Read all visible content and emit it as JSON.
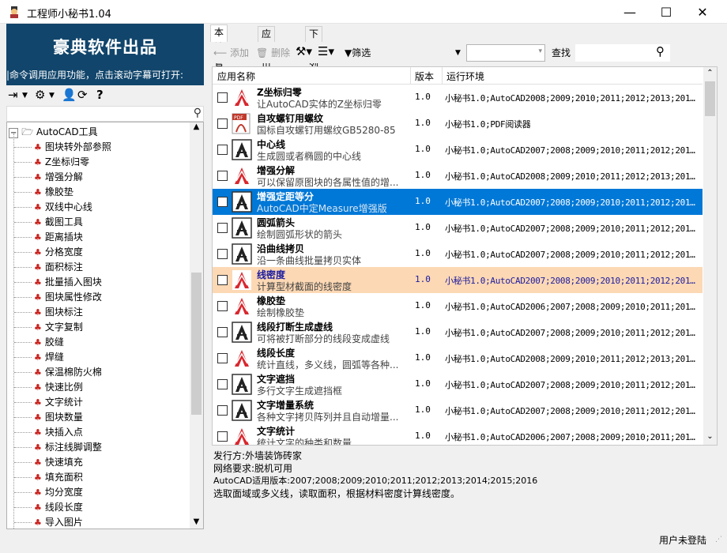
{
  "window": {
    "title": "工程师小秘书1.04",
    "minimize": "—",
    "maximize": "☐",
    "close": "✕"
  },
  "banner": {
    "title": "豪典软件出品",
    "marquee": "|命令调用应用功能，点击滚动字幕可打开:"
  },
  "left_toolbar": {
    "icons": [
      "exit-icon",
      "settings-icon",
      "user-icon",
      "refresh-icon",
      "help-icon"
    ]
  },
  "tree": {
    "root": "AutoCAD工具",
    "items": [
      "图块转外部参照",
      "Z坐标归零",
      "增强分解",
      "橡胶垫",
      "双线中心线",
      "截图工具",
      "距离插块",
      "分格宽度",
      "面积标注",
      "批量插入图块",
      "图块属性修改",
      "图块标注",
      "文字复制",
      "胶缝",
      "焊缝",
      "保温棉防火棉",
      "快速比例",
      "文字统计",
      "图块数量",
      "块插入点",
      "标注线脚调整",
      "快速填充",
      "填充面积",
      "均分宽度",
      "线段长度",
      "导入图片"
    ]
  },
  "tabs": [
    "本地管理",
    "应用市场",
    "下载列表"
  ],
  "toolbar": {
    "add": "添加",
    "delete": "删除",
    "filter": "筛选",
    "find_label": "查找"
  },
  "columns": {
    "name": "应用名称",
    "version": "版本",
    "env": "运行环境"
  },
  "rows": [
    {
      "name": "Z坐标归零",
      "desc": "让AutoCAD实体的Z坐标归零",
      "ver": "1.0",
      "env": "小秘书1.0;AutoCAD2008;2009;2010;2011;2012;2013;2014...",
      "icon": "cad"
    },
    {
      "name": "自攻螺钉用螺纹",
      "desc": "国标自攻螺钉用螺纹GB5280-85",
      "ver": "1.0",
      "env": "小秘书1.0;PDF阅读器",
      "icon": "pdf"
    },
    {
      "name": "中心线",
      "desc": "生成圆或者椭圆的中心线",
      "ver": "1.0",
      "env": "小秘书1.0;AutoCAD2007;2008;2009;2010;2011;2012;2013...",
      "icon": "a"
    },
    {
      "name": "增强分解",
      "desc": "可以保留原图块的各属性值的增...",
      "ver": "1.0",
      "env": "小秘书1.0;AutoCAD2008;2009;2010;2011;2012;2013;2014...",
      "icon": "cad"
    },
    {
      "name": "增强定距等分",
      "desc": "AutoCAD中定Measure增强版",
      "ver": "1.0",
      "env": "小秘书1.0;AutoCAD2007;2008;2009;2010;2011;2012;2013...",
      "icon": "a"
    },
    {
      "name": "圆弧箭头",
      "desc": "绘制圆弧形状的箭头",
      "ver": "1.0",
      "env": "小秘书1.0;AutoCAD2007;2008;2009;2010;2011;2012;2013...",
      "icon": "a"
    },
    {
      "name": "沿曲线拷贝",
      "desc": "沿一条曲线批量拷贝实体",
      "ver": "1.0",
      "env": "小秘书1.0;AutoCAD2007;2008;2009;2010;2011;2012;2013...",
      "icon": "a"
    },
    {
      "name": "线密度",
      "desc": "计算型材截面的线密度",
      "ver": "1.0",
      "env": "小秘书1.0;AutoCAD2007;2008;2009;2010;2011;2012;2013...",
      "icon": "cad"
    },
    {
      "name": "橡胶垫",
      "desc": "绘制橡胶垫",
      "ver": "1.0",
      "env": "小秘书1.0;AutoCAD2006;2007;2008;2009;2010;2011;2012...",
      "icon": "cad"
    },
    {
      "name": "线段打断生成虚线",
      "desc": "可将被打断部分的线段变成虚线",
      "ver": "1.0",
      "env": "小秘书1.0;AutoCAD2007;2008;2009;2010;2011;2012;2013...",
      "icon": "a"
    },
    {
      "name": "线段长度",
      "desc": "统计直线，多义线，圆弧等各种...",
      "ver": "1.0",
      "env": "小秘书1.0;AutoCAD2008;2009;2010;2011;2012;2013;2014...",
      "icon": "cad"
    },
    {
      "name": "文字遮挡",
      "desc": "多行文字生成遮挡框",
      "ver": "1.0",
      "env": "小秘书1.0;AutoCAD2007;2008;2009;2010;2011;2012;2013...",
      "icon": "a"
    },
    {
      "name": "文字增量系统",
      "desc": "各种文字拷贝阵列并且自动增量...",
      "ver": "1.0",
      "env": "小秘书1.0;AutoCAD2007;2008;2009;2010;2011;2012;2013...",
      "icon": "a"
    },
    {
      "name": "文字统计",
      "desc": "统计文字的种类和数量",
      "ver": "1.0",
      "env": "小秘书1.0;AutoCAD2006;2007;2008;2009;2010;2011;2012...",
      "icon": "cad"
    }
  ],
  "info": {
    "publisher": "发行方:外墙装饰砖家",
    "network": "网络要求:脱机可用",
    "versions": "AutoCAD适用版本:2007;2008;2009;2010;2011;2012;2013;2014;2015;2016",
    "description": "选取面域或多义线，读取面积，根据材料密度计算线密度。"
  },
  "status": {
    "login": "用户未登陆"
  }
}
